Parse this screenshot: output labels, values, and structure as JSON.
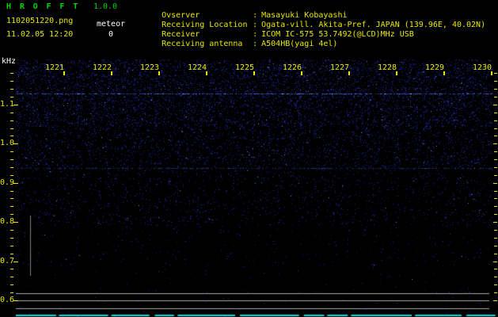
{
  "app": {
    "title": "H R O F F T",
    "version": "1.0.0"
  },
  "session": {
    "filename": "1102051220.png",
    "mode_label": "meteor",
    "count": "0",
    "datetime": "11.02.05 12:20"
  },
  "info": {
    "colon": ":",
    "rows": [
      {
        "label": "Ovserver",
        "value": "Masayuki Kobayashi"
      },
      {
        "label": "Receiving Location",
        "value": "Ogata-vill. Akita-Pref. JAPAN (139.96E, 40.02N)"
      },
      {
        "label": "Receiver",
        "value": "ICOM IC-575 53.7492(@LCD)MHz USB"
      },
      {
        "label": "Receiving antenna",
        "value": "A504HB(yagi 4el)"
      }
    ]
  },
  "chart_data": {
    "type": "heatmap",
    "title": "HROFFT 10-minute radio meteor echo spectrogram",
    "ylabel": "kHz",
    "x_ticks": [
      "1221",
      "1222",
      "1223",
      "1224",
      "1225",
      "1226",
      "1227",
      "1228",
      "1229",
      "1230"
    ],
    "y_ticks": [
      "1.1",
      "1.0",
      "0.9",
      "0.8",
      "0.7",
      "0.6"
    ],
    "ylim_khz": [
      0.56,
      1.22
    ],
    "x_minutes_range": [
      "1221",
      "1230"
    ],
    "meteor_count": 0,
    "interference_lines_khz": [
      1.13,
      0.94
    ],
    "reference_lines_khz": [
      0.62,
      0.6,
      0.58
    ],
    "baseline_khz": 0.56,
    "legend": "none",
    "grid": "off"
  },
  "colors": {
    "background": "#000000",
    "title_green": "#00d400",
    "text_yellow": "#e8e800",
    "text_white": "#ffffff",
    "noise_blue": "#2a2ad0",
    "bright_line_blue": "#4a6af0",
    "grid_gray": "#a8a8a8",
    "level_bar_gray": "#808080",
    "baseline_cyan": "#00dcdc"
  }
}
